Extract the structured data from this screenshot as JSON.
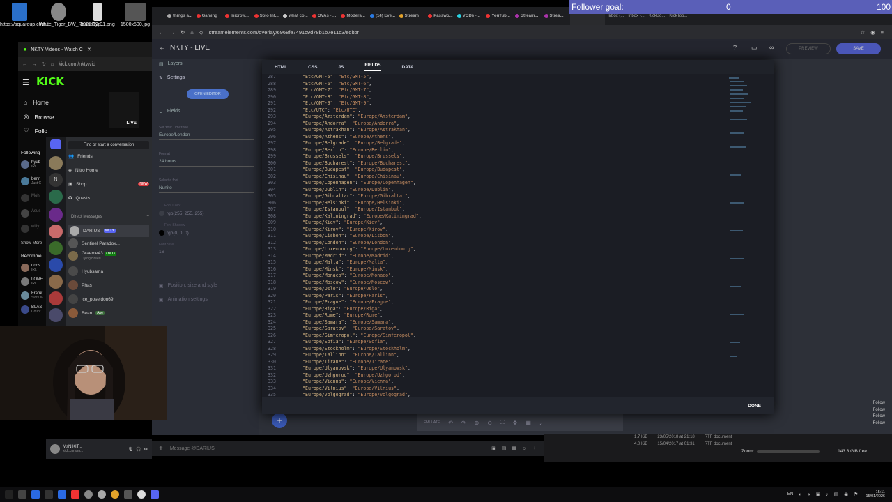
{
  "desktop_icons": [
    {
      "label": "https://squareup.com...",
      "color": "#2a6fc9"
    },
    {
      "label": "White_Tiger_BW_RoundTyp...",
      "color": "#888"
    },
    {
      "label": "2025-12-01.png",
      "color": "#ddd"
    },
    {
      "label": "1500x500.jpg",
      "color": "#555"
    }
  ],
  "kick": {
    "tab_title": "NKTY Videos - Watch C",
    "url": "kick.com/nkty/vid",
    "logo": "KICK",
    "nav": [
      "Home",
      "Browse",
      "Follo"
    ],
    "following_label": "Following",
    "following": [
      {
        "name": "hyub",
        "sub": "IRL"
      },
      {
        "name": "benn",
        "sub": "Just C"
      },
      {
        "name": "Mohi",
        "sub": ""
      },
      {
        "name": "Asus",
        "sub": ""
      },
      {
        "name": "willy",
        "sub": ""
      }
    ],
    "show_more": "Show More",
    "recommended_label": "Recomme",
    "recommended": [
      {
        "name": "qoqs",
        "sub": "IRL"
      },
      {
        "name": "LONE",
        "sub": "IRL"
      },
      {
        "name": "Frank",
        "sub": "Slots &"
      },
      {
        "name": "BLAS",
        "sub": "Count"
      }
    ],
    "live_badge": "LIVE"
  },
  "discord": {
    "search_placeholder": "Find or start a conversation",
    "menu": [
      "Friends",
      "Nitro Home",
      "Shop",
      "Quests"
    ],
    "new_badge": "NEW",
    "dm_header": "Direct Messages",
    "dms": [
      {
        "name": "DARIUS",
        "tag": "NKTY",
        "sub": ""
      },
      {
        "name": "Sentinel Paradox...",
        "tag": "",
        "sub": ""
      },
      {
        "name": "Graeme43",
        "tag": "XBOX",
        "sub": "Dying Breed"
      },
      {
        "name": "Hyubsama",
        "tag": "",
        "sub": ""
      },
      {
        "name": "Phas",
        "tag": "",
        "sub": ""
      },
      {
        "name": "ice_poseidon69",
        "tag": "",
        "sub": ""
      },
      {
        "name": "Bean",
        "tag": "Ape",
        "sub": ""
      }
    ],
    "user_name": "MsNIKIT...",
    "user_sub": "kick.com/m...",
    "message_placeholder": "Message @DARIUS"
  },
  "browser": {
    "tabs": [
      "",
      "things a...",
      "Gaming",
      "microw...",
      "Solo Inf...",
      "what co...",
      "OVAs - ...",
      "Modera...",
      "(14) Eve...",
      "Stream",
      "Passwo...",
      "VODs -...",
      "YouTub...",
      "Stream...",
      "Strea...",
      "Inbox (...",
      "Inbox -...",
      "KickBo...",
      "KickToo..."
    ],
    "url": "streamelements.com/overlay/6968fe7491c9d78b1b7e11c3/editor",
    "page_title": "NKTY - LIVE",
    "preview_label": "PREVIEW",
    "save_label": "SAVE"
  },
  "left_panel": {
    "layers": "Layers",
    "settings": "Settings",
    "open_editor": "OPEN EDITOR",
    "fields": "Fields",
    "timezone_label": "Set Your Timezone",
    "timezone_value": "Europe/London",
    "format_label": "Format",
    "format_value": "24 hours",
    "font_label": "Select a font",
    "font_value": "Nunito",
    "font_color_label": "Font Color",
    "font_color_value": "rgb(255, 255, 255)",
    "shadow_label": "Font Shadow",
    "shadow_value": "rgb(0, 0, 0)",
    "size_label": "Font Size",
    "size_value": "16",
    "position": "Position, size and style",
    "animation": "Animation settings"
  },
  "follower_goal": {
    "label": "Follower goal:",
    "current": "0",
    "target": "100"
  },
  "modal": {
    "tabs": [
      "HTML",
      "CSS",
      "JS",
      "FIELDS",
      "DATA"
    ],
    "active_tab": "FIELDS",
    "done_label": "DONE",
    "lines": [
      {
        "n": "287",
        "k": "\"Etc/GMT-5\"",
        "v": "\"Etc/GMT-5\""
      },
      {
        "n": "288",
        "k": "\"Etc/GMT-6\"",
        "v": "\"Etc/GMT-6\""
      },
      {
        "n": "289",
        "k": "\"Etc/GMT-7\"",
        "v": "\"Etc/GMT-7\""
      },
      {
        "n": "290",
        "k": "\"Etc/GMT-8\"",
        "v": "\"Etc/GMT-8\""
      },
      {
        "n": "291",
        "k": "\"Etc/GMT-9\"",
        "v": "\"Etc/GMT-9\""
      },
      {
        "n": "292",
        "k": "\"Etc/UTC\"",
        "v": "\"Etc/UTC\""
      },
      {
        "n": "293",
        "k": "\"Europe/Amsterdam\"",
        "v": "\"Europe/Amsterdam\""
      },
      {
        "n": "294",
        "k": "\"Europe/Andorra\"",
        "v": "\"Europe/Andorra\""
      },
      {
        "n": "295",
        "k": "\"Europe/Astrakhan\"",
        "v": "\"Europe/Astrakhan\""
      },
      {
        "n": "296",
        "k": "\"Europe/Athens\"",
        "v": "\"Europe/Athens\""
      },
      {
        "n": "297",
        "k": "\"Europe/Belgrade\"",
        "v": "\"Europe/Belgrade\""
      },
      {
        "n": "298",
        "k": "\"Europe/Berlin\"",
        "v": "\"Europe/Berlin\""
      },
      {
        "n": "299",
        "k": "\"Europe/Brussels\"",
        "v": "\"Europe/Brussels\""
      },
      {
        "n": "300",
        "k": "\"Europe/Bucharest\"",
        "v": "\"Europe/Bucharest\""
      },
      {
        "n": "301",
        "k": "\"Europe/Budapest\"",
        "v": "\"Europe/Budapest\""
      },
      {
        "n": "302",
        "k": "\"Europe/Chisinau\"",
        "v": "\"Europe/Chisinau\""
      },
      {
        "n": "303",
        "k": "\"Europe/Copenhagen\"",
        "v": "\"Europe/Copenhagen\""
      },
      {
        "n": "304",
        "k": "\"Europe/Dublin\"",
        "v": "\"Europe/Dublin\""
      },
      {
        "n": "305",
        "k": "\"Europe/Gibraltar\"",
        "v": "\"Europe/Gibraltar\""
      },
      {
        "n": "306",
        "k": "\"Europe/Helsinki\"",
        "v": "\"Europe/Helsinki\""
      },
      {
        "n": "307",
        "k": "\"Europe/Istanbul\"",
        "v": "\"Europe/Istanbul\""
      },
      {
        "n": "308",
        "k": "\"Europe/Kaliningrad\"",
        "v": "\"Europe/Kaliningrad\""
      },
      {
        "n": "309",
        "k": "\"Europe/Kiev\"",
        "v": "\"Europe/Kiev\""
      },
      {
        "n": "310",
        "k": "\"Europe/Kirov\"",
        "v": "\"Europe/Kirov\""
      },
      {
        "n": "311",
        "k": "\"Europe/Lisbon\"",
        "v": "\"Europe/Lisbon\""
      },
      {
        "n": "312",
        "k": "\"Europe/London\"",
        "v": "\"Europe/London\""
      },
      {
        "n": "313",
        "k": "\"Europe/Luxembourg\"",
        "v": "\"Europe/Luxembourg\""
      },
      {
        "n": "314",
        "k": "\"Europe/Madrid\"",
        "v": "\"Europe/Madrid\""
      },
      {
        "n": "315",
        "k": "\"Europe/Malta\"",
        "v": "\"Europe/Malta\""
      },
      {
        "n": "316",
        "k": "\"Europe/Minsk\"",
        "v": "\"Europe/Minsk\""
      },
      {
        "n": "317",
        "k": "\"Europe/Monaco\"",
        "v": "\"Europe/Monaco\""
      },
      {
        "n": "318",
        "k": "\"Europe/Moscow\"",
        "v": "\"Europe/Moscow\""
      },
      {
        "n": "319",
        "k": "\"Europe/Oslo\"",
        "v": "\"Europe/Oslo\""
      },
      {
        "n": "320",
        "k": "\"Europe/Paris\"",
        "v": "\"Europe/Paris\""
      },
      {
        "n": "321",
        "k": "\"Europe/Prague\"",
        "v": "\"Europe/Prague\""
      },
      {
        "n": "322",
        "k": "\"Europe/Riga\"",
        "v": "\"Europe/Riga\""
      },
      {
        "n": "323",
        "k": "\"Europe/Rome\"",
        "v": "\"Europe/Rome\""
      },
      {
        "n": "324",
        "k": "\"Europe/Samara\"",
        "v": "\"Europe/Samara\""
      },
      {
        "n": "325",
        "k": "\"Europe/Saratov\"",
        "v": "\"Europe/Saratov\""
      },
      {
        "n": "326",
        "k": "\"Europe/Simferopol\"",
        "v": "\"Europe/Simferopol\""
      },
      {
        "n": "327",
        "k": "\"Europe/Sofia\"",
        "v": "\"Europe/Sofia\""
      },
      {
        "n": "328",
        "k": "\"Europe/Stockholm\"",
        "v": "\"Europe/Stockholm\""
      },
      {
        "n": "329",
        "k": "\"Europe/Tallinn\"",
        "v": "\"Europe/Tallinn\""
      },
      {
        "n": "330",
        "k": "\"Europe/Tirane\"",
        "v": "\"Europe/Tirane\""
      },
      {
        "n": "331",
        "k": "\"Europe/Ulyanovsk\"",
        "v": "\"Europe/Ulyanovsk\""
      },
      {
        "n": "332",
        "k": "\"Europe/Uzhgorod\"",
        "v": "\"Europe/Uzhgorod\""
      },
      {
        "n": "333",
        "k": "\"Europe/Vienna\"",
        "v": "\"Europe/Vienna\""
      },
      {
        "n": "334",
        "k": "\"Europe/Vilnius\"",
        "v": "\"Europe/Vilnius\""
      },
      {
        "n": "335",
        "k": "\"Europe/Volgograd\"",
        "v": "\"Europe/Volgograd\""
      }
    ]
  },
  "bottom_toolbar": {
    "emulate": "EMULATE"
  },
  "file_list": [
    {
      "size": "1.7 KiB",
      "date": "23/05/2018 at 21:18",
      "type": "RTF document"
    },
    {
      "size": "4.0 KiB",
      "date": "15/04/2017 at 01:31",
      "type": "RTF document"
    }
  ],
  "zoom_label": "Zoom:",
  "disk_free": "143.3 GiB free",
  "overlay_followers": [
    "Follow",
    "Follow",
    "Follow",
    "Follow"
  ],
  "taskbar": {
    "lang": "EN",
    "time": "15:11",
    "date": "15/01/2026"
  },
  "colors": {
    "kick_green": "#53fc18",
    "se_save": "#4a56b8",
    "follower_bar": "#5a5fb8",
    "discord_blurple": "#5865f2"
  }
}
